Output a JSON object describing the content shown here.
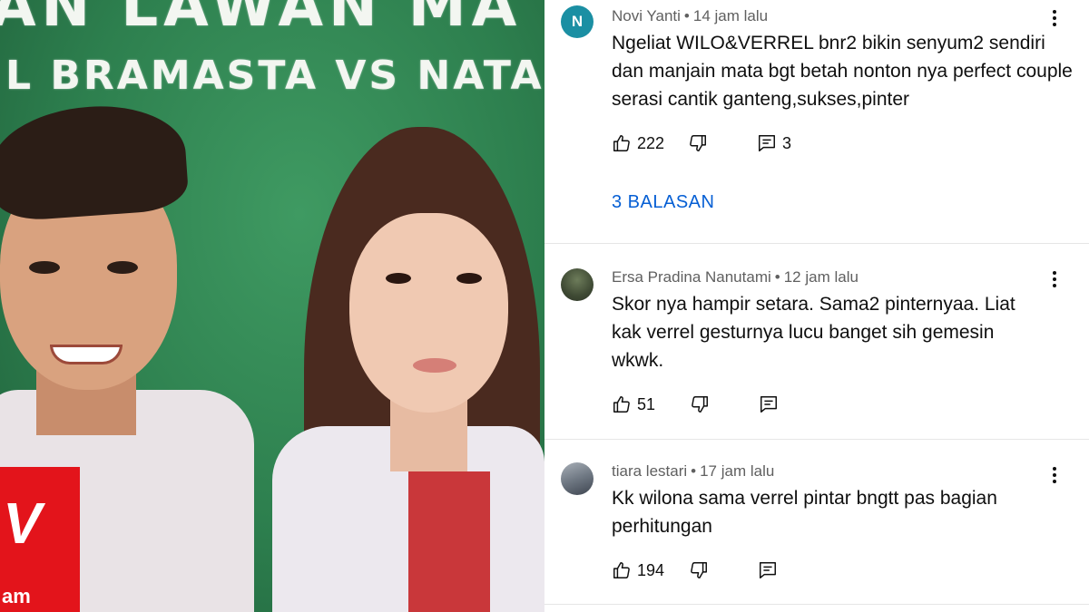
{
  "thumbnail": {
    "headline_top": "AN LAWAN MA",
    "headline_bottom": "L BRAMASTA VS NATASHA",
    "logo_mark": "V",
    "logo_sub": "am"
  },
  "comments": [
    {
      "avatar_letter": "N",
      "avatar_color": "#1b8fa3",
      "author": "Novi Yanti",
      "separator": "•",
      "time": "14 jam lalu",
      "text": "Ngeliat WILO&VERREL bnr2 bikin senyum2 sendiri dan manjain mata bgt betah nonton nya perfect couple serasi cantik ganteng,sukses,pinter",
      "likes": "222",
      "reply_count": "3",
      "replies_link": "3 BALASAN"
    },
    {
      "avatar_letter": "",
      "author": "Ersa Pradina Nanutami",
      "separator": "•",
      "time": "12 jam lalu",
      "text": "Skor nya hampir setara. Sama2 pinternyaa. Liat kak verrel gesturnya lucu banget sih gemesin wkwk.",
      "likes": "51",
      "reply_count": ""
    },
    {
      "avatar_letter": "",
      "author": "tiara lestari",
      "separator": "•",
      "time": "17 jam lalu",
      "text": "Kk wilona sama verrel pintar bngtt pas bagian perhitungan",
      "likes": "194",
      "reply_count": ""
    }
  ],
  "icons": {
    "like": "thumbs-up-icon",
    "dislike": "thumbs-down-icon",
    "reply": "comment-icon",
    "more": "more-vert-icon"
  },
  "colors": {
    "link": "#065fd4",
    "meta": "#606060",
    "text": "#0f0f0f",
    "thumbnail_bg": "#2d7f4e",
    "logo_red": "#e3141b"
  }
}
